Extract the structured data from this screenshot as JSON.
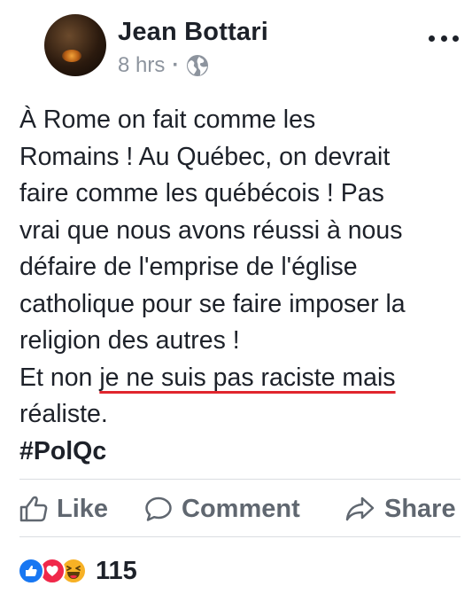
{
  "post": {
    "author": "Jean Bottari",
    "time": "8 hrs",
    "separator": "·",
    "audience_icon": "globe-icon",
    "menu_icon": "more-options-icon",
    "text_lines": [
      "À Rome on fait comme les",
      "Romains ! Au Québec, on devrait",
      "faire comme les québécois !  Pas",
      "vrai que nous avons réussi à nous",
      "défaire de l'emprise de l'église",
      "catholique pour se faire imposer la",
      "religion des autres !"
    ],
    "line8_prefix": "Et non ",
    "line8_underlined": "je ne suis pas raciste mais",
    "line9": "réaliste.",
    "hashtag": "#PolQc",
    "underline_color": "#e0252d"
  },
  "actions": {
    "like_label": "Like",
    "comment_label": "Comment",
    "share_label": "Share"
  },
  "reactions": {
    "types": [
      "like",
      "love",
      "haha"
    ],
    "count": "115"
  },
  "colors": {
    "text": "#1d2129",
    "meta": "#8d949e",
    "action": "#606770",
    "divider": "#dadde1",
    "like_blue": "#1877f2",
    "love_red": "#f0284a",
    "haha_yellow": "#f7b125"
  }
}
